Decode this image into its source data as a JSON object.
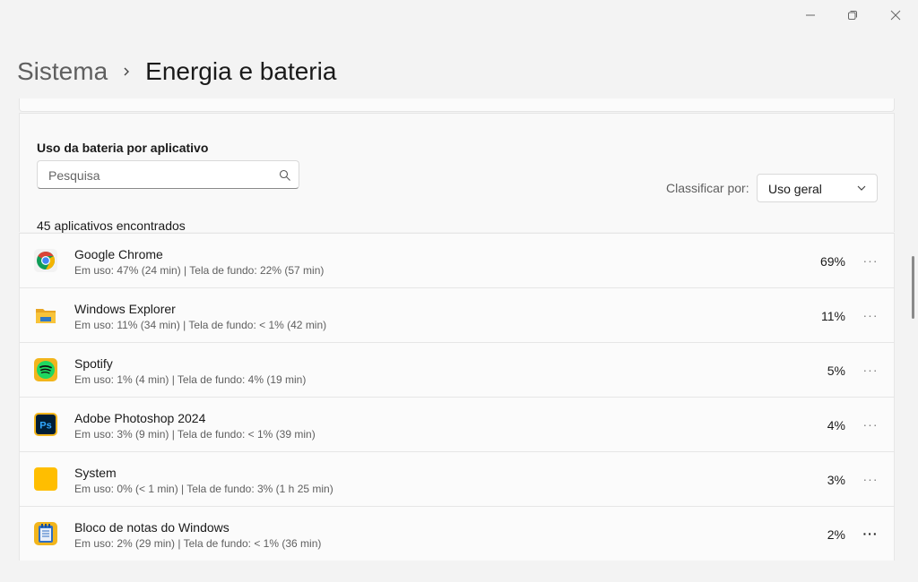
{
  "window": {
    "minimize_icon": "minimize-icon",
    "maximize_icon": "restore-icon",
    "close_icon": "close-icon"
  },
  "breadcrumb": {
    "parent": "Sistema",
    "current": "Energia e bateria"
  },
  "section": {
    "title": "Uso da bateria por aplicativo",
    "search_placeholder": "Pesquisa",
    "search_value": "",
    "sort_label": "Classificar por:",
    "sort_value": "Uso geral",
    "count_text": "45 aplicativos encontrados"
  },
  "apps": [
    {
      "name": "Google Chrome",
      "detail": "Em uso: 47% (24 min) | Tela de fundo: 22% (57 min)",
      "percent": "69%",
      "icon": "chrome-icon"
    },
    {
      "name": "Windows Explorer",
      "detail": "Em uso: 11% (34 min) | Tela de fundo: < 1% (42 min)",
      "percent": "11%",
      "icon": "folder-icon"
    },
    {
      "name": "Spotify",
      "detail": "Em uso: 1% (4 min) | Tela de fundo: 4% (19 min)",
      "percent": "5%",
      "icon": "spotify-icon"
    },
    {
      "name": "Adobe Photoshop 2024",
      "detail": "Em uso: 3% (9 min) | Tela de fundo: < 1% (39 min)",
      "percent": "4%",
      "icon": "photoshop-icon"
    },
    {
      "name": "System",
      "detail": "Em uso: 0% (< 1 min) | Tela de fundo: 3% (1 h 25 min)",
      "percent": "3%",
      "icon": "system-icon"
    },
    {
      "name": "Bloco de notas do Windows",
      "detail": "Em uso: 2% (29 min) | Tela de fundo: < 1% (36 min)",
      "percent": "2%",
      "icon": "notepad-icon"
    }
  ],
  "more_glyph": "···",
  "colors": {
    "chrome_red": "#db4437",
    "chrome_yellow": "#f4b400",
    "chrome_green": "#0f9d58",
    "chrome_blue": "#4285f4",
    "folder_yellow": "#f8c43a",
    "spotify_green": "#1ed760",
    "photoshop_blue": "#31a8ff",
    "photoshop_bg": "#001e36",
    "system_yellow": "#ffbe00"
  }
}
